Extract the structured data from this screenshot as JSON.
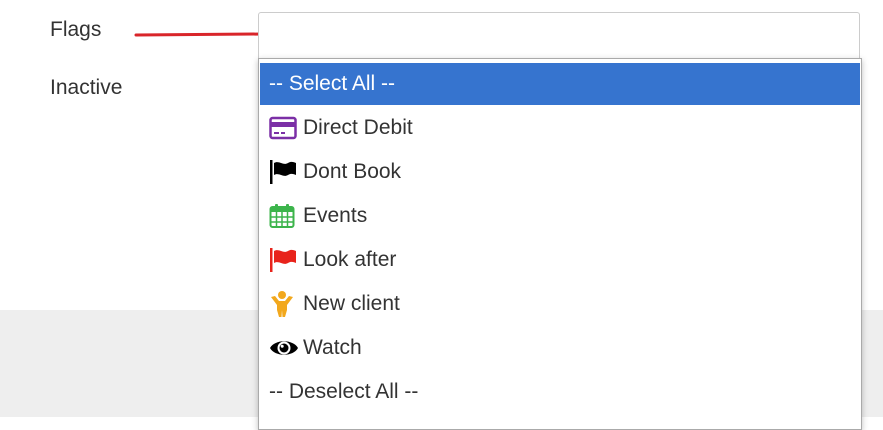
{
  "form": {
    "flags_label": "Flags",
    "inactive_label": "Inactive"
  },
  "dropdown": {
    "select_all": "-- Select All --",
    "deselect_all": "-- Deselect All --",
    "options": [
      {
        "label": "Direct Debit",
        "icon": "credit-card-icon",
        "color": "#7b2fa6"
      },
      {
        "label": "Dont Book",
        "icon": "flag-icon",
        "color": "#000000"
      },
      {
        "label": "Events",
        "icon": "calendar-icon",
        "color": "#3cb44b"
      },
      {
        "label": "Look after",
        "icon": "flag-icon",
        "color": "#e8231b"
      },
      {
        "label": "New client",
        "icon": "child-icon",
        "color": "#f2a81d"
      },
      {
        "label": "Watch",
        "icon": "eye-icon",
        "color": "#000000"
      }
    ]
  },
  "colors": {
    "highlight": "#3674cf",
    "arrow": "#d9252a",
    "footer": "#eeeeee"
  }
}
